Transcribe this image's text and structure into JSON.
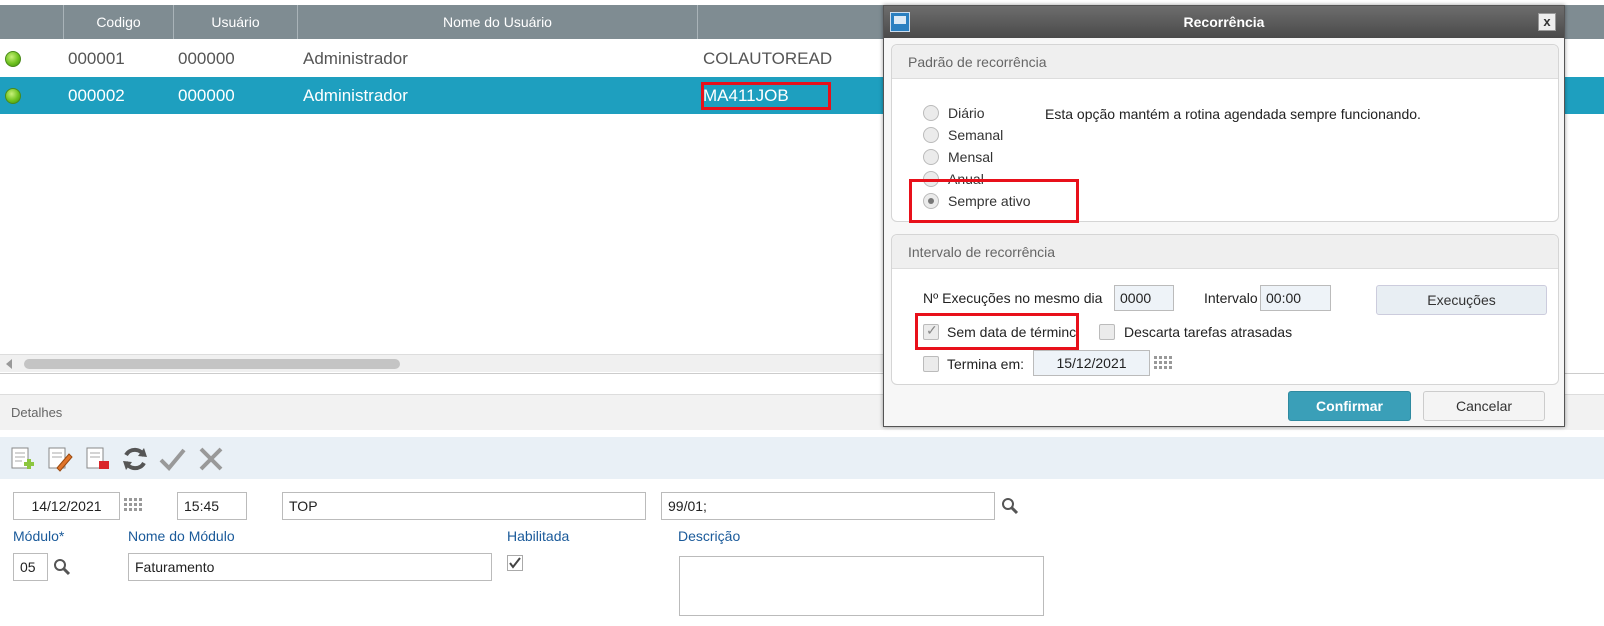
{
  "grid": {
    "headers": [
      "Codigo",
      "Usuário",
      "Nome do Usuário"
    ],
    "rows": [
      {
        "codigo": "000001",
        "usuario": "000000",
        "nome": "Administrador",
        "rotina": "COLAUTOREAD"
      },
      {
        "codigo": "000002",
        "usuario": "000000",
        "nome": "Administrador",
        "rotina": "MA411JOB"
      }
    ],
    "status_color": "#6fc21f",
    "selected_color": "#1e9fbf"
  },
  "details": {
    "title": "Detalhes",
    "date": "14/12/2021",
    "time": "15:45",
    "env": "TOP",
    "companies": "99/01;",
    "module_label": "Módulo*",
    "module_value": "05",
    "module_name_label": "Nome do Módulo",
    "module_name_value": "Faturamento",
    "enabled_label": "Habilitada",
    "description_label": "Descrição",
    "description_value": ""
  },
  "toolbar": {
    "icons": [
      "add-doc-icon",
      "edit-doc-icon",
      "delete-doc-icon",
      "refresh-icon",
      "check-icon",
      "cancel-icon"
    ]
  },
  "dialog": {
    "title": "Recorrência",
    "close": "x",
    "pattern": {
      "title": "Padrão de recorrência",
      "options": [
        "Diário",
        "Semanal",
        "Mensal",
        "Anual",
        "Sempre ativo"
      ],
      "selected": "Sempre ativo",
      "info": "Esta opção mantém a rotina agendada sempre funcionando."
    },
    "interval": {
      "title": "Intervalo de recorrência",
      "exec_label": "Nº Execuções no mesmo dia",
      "exec_value": "0000",
      "interval_label": "Intervalo",
      "interval_value": "00:00",
      "exec_button": "Execuções",
      "no_end_label": "Sem data de términc",
      "discard_label": "Descarta tarefas atrasadas",
      "ends_label": "Termina em:",
      "ends_value": "15/12/2021"
    },
    "confirm": "Confirmar",
    "cancel": "Cancelar",
    "confirm_color": "#3a9fb8",
    "highlight_color": "#e8101a"
  }
}
